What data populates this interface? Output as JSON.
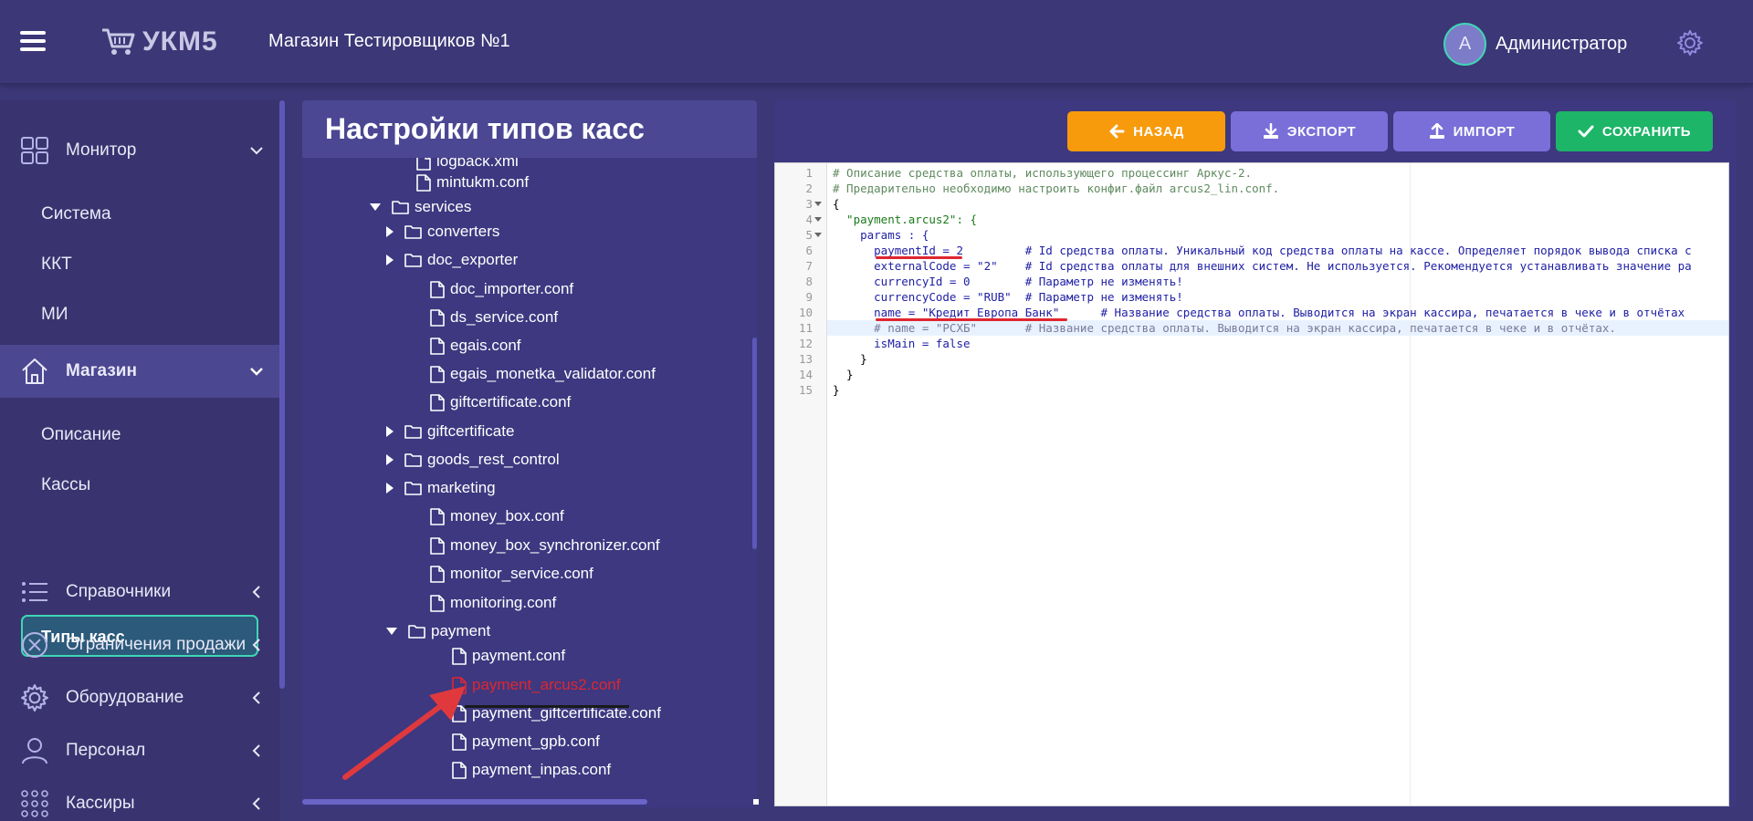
{
  "header": {
    "logo_text": "УКМ5",
    "store_name": "Магазин Тестировщиков №1",
    "avatar_letter": "А",
    "user_name": "Администратор"
  },
  "sidebar": {
    "sections": [
      {
        "label": "Монитор",
        "icon": "monitor-grid-icon"
      },
      {
        "label": "Магазин",
        "icon": "house-icon"
      },
      {
        "label": "Справочники",
        "icon": "list-icon"
      },
      {
        "label": "Ограничения продажи",
        "icon": "circle-x-icon"
      },
      {
        "label": "Оборудование",
        "icon": "gear-icon"
      },
      {
        "label": "Персонал",
        "icon": "person-icon"
      },
      {
        "label": "Кассиры",
        "icon": "dots-grid-icon"
      }
    ],
    "monitor_subitems": [
      "Система",
      "ККТ",
      "МИ"
    ],
    "store_subitems": [
      "Описание",
      "Кассы",
      "Типы касс"
    ]
  },
  "tree": {
    "title": "Настройки типов касс",
    "nodes": [
      {
        "label": "logback.xml",
        "type": "file"
      },
      {
        "label": "mintukm.conf",
        "type": "file"
      },
      {
        "label": "services",
        "type": "folder-open"
      },
      {
        "label": "converters",
        "type": "folder"
      },
      {
        "label": "doc_exporter",
        "type": "folder"
      },
      {
        "label": "doc_importer.conf",
        "type": "file"
      },
      {
        "label": "ds_service.conf",
        "type": "file"
      },
      {
        "label": "egais.conf",
        "type": "file"
      },
      {
        "label": "egais_monetka_validator.conf",
        "type": "file"
      },
      {
        "label": "giftcertificate.conf",
        "type": "file"
      },
      {
        "label": "giftcertificate",
        "type": "folder"
      },
      {
        "label": "goods_rest_control",
        "type": "folder"
      },
      {
        "label": "marketing",
        "type": "folder"
      },
      {
        "label": "money_box.conf",
        "type": "file"
      },
      {
        "label": "money_box_synchronizer.conf",
        "type": "file"
      },
      {
        "label": "monitor_service.conf",
        "type": "file"
      },
      {
        "label": "monitoring.conf",
        "type": "file"
      },
      {
        "label": "payment",
        "type": "folder-open"
      },
      {
        "label": "payment.conf",
        "type": "file"
      },
      {
        "label": "payment_arcus2.conf",
        "type": "file-selected"
      },
      {
        "label": "payment_giftcertificate.conf",
        "type": "file"
      },
      {
        "label": "payment_gpb.conf",
        "type": "file"
      },
      {
        "label": "payment_inpas.conf",
        "type": "file"
      }
    ]
  },
  "toolbar": {
    "back_label": "НАЗАД",
    "export_label": "ЭКСПОРТ",
    "import_label": "ИМПОРТ",
    "save_label": "СОХРАНИТЬ"
  },
  "editor": {
    "active_line": 11,
    "lines": [
      "# Описание средства оплаты, использующего процессинг Аркус-2.",
      "# Предарительно необходимо настроить конфиг.файл arcus2_lin.conf.",
      "{",
      "  \"payment.arcus2\": {",
      "    params : {",
      "      paymentId = 2         # Id средства оплаты. Уникальный код средства оплаты на кассе. Определяет порядок вывода списка с",
      "      externalCode = \"2\"    # Id средства оплаты для внешних систем. Не используется. Рекомендуется устанавливать значение ра",
      "      currencyId = 0        # Параметр не изменять!",
      "      currencyCode = \"RUB\"  # Параметр не изменять!",
      "      name = \"Кредит Европа Банк\"      # Название средства оплаты. Выводится на экран кассира, печатается в чеке и в отчётах",
      "      # name = \"РСХБ\"       # Название средства оплаты. Выводится на экран кассира, печатается в чеке и в отчётах.",
      "      isMain = false",
      "    }",
      "  }",
      "}"
    ]
  },
  "colors": {
    "background": "#3c3777",
    "accent_teal": "#3fd6b5",
    "back_button": "#f79a0c",
    "export_button": "#7a6fd8",
    "save_button": "#1db568",
    "highlight_red": "#e0262f"
  }
}
